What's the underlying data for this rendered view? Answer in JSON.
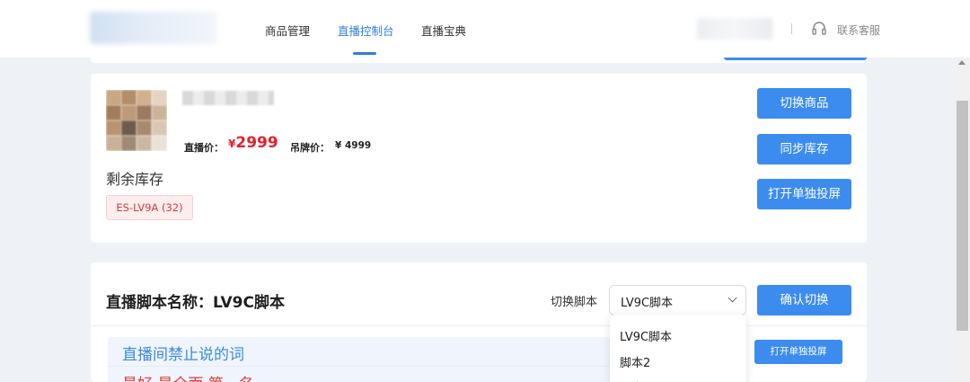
{
  "nav": {
    "items": [
      {
        "label": "商品管理"
      },
      {
        "label": "直播控制台"
      },
      {
        "label": "直播宝典"
      }
    ],
    "active_index": 1,
    "support_label": "联系客服"
  },
  "product": {
    "live_price_label": "直播价：",
    "currency": "¥",
    "live_price": "2999",
    "tag_price_label": "吊牌价：",
    "tag_price": "¥ 4999",
    "stock_label": "剩余库存",
    "stock_chip": "ES-LV9A (32)",
    "buttons": {
      "switch": "切换商品",
      "sync": "同步库存",
      "open_screen": "打开单独投屏"
    }
  },
  "script": {
    "title": "直播脚本名称：LV9C脚本",
    "switch_label": "切换脚本",
    "selected": "LV9C脚本",
    "confirm": "确认切换",
    "options": [
      "LV9C脚本",
      "脚本2",
      "脚本"
    ],
    "banned_title": "直播间禁止说的词",
    "banned_first": "最好 最全面 第一名",
    "open_screen_small": "打开单独投屏"
  },
  "colors": {
    "accent": "#3c8cf0",
    "price_red": "#e0222a"
  }
}
